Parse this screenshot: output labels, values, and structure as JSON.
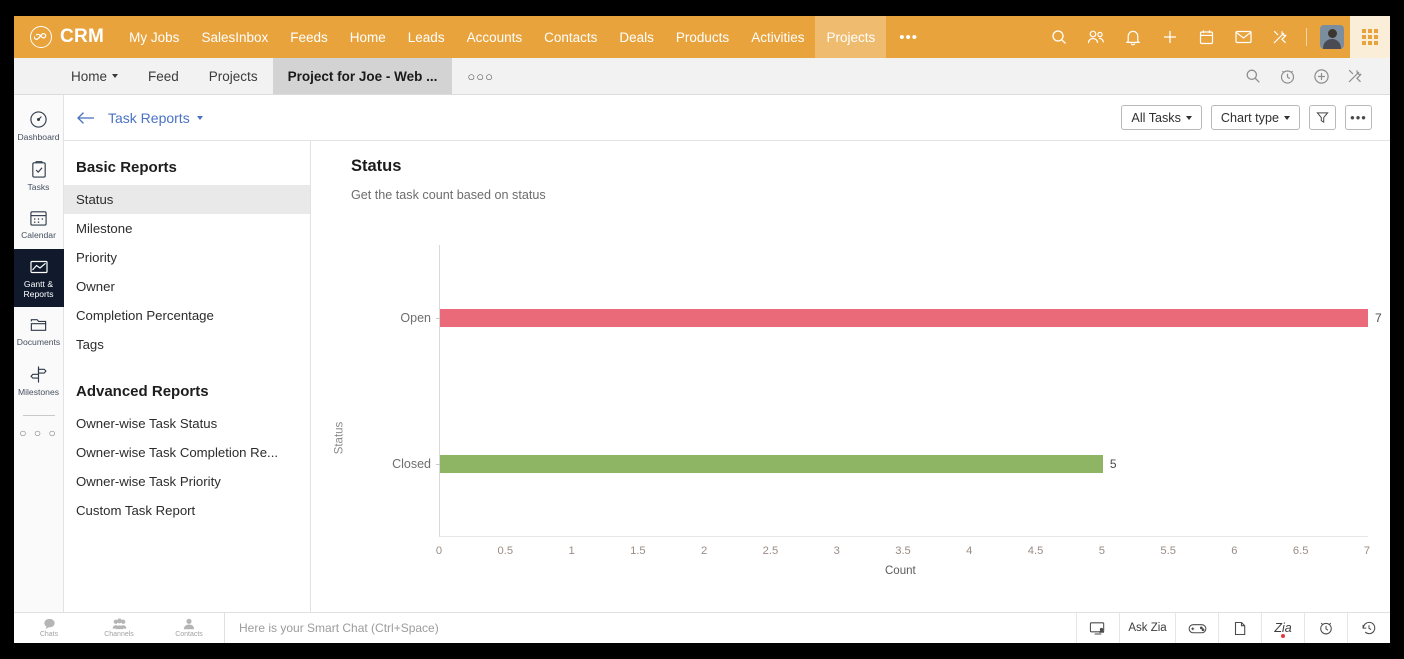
{
  "topbar": {
    "logo_text": "CRM",
    "logo_icon": "zoho-infinity-icon",
    "nav": [
      {
        "label": "My Jobs",
        "active": false
      },
      {
        "label": "SalesInbox",
        "active": false
      },
      {
        "label": "Feeds",
        "active": false
      },
      {
        "label": "Home",
        "active": false
      },
      {
        "label": "Leads",
        "active": false
      },
      {
        "label": "Accounts",
        "active": false
      },
      {
        "label": "Contacts",
        "active": false
      },
      {
        "label": "Deals",
        "active": false
      },
      {
        "label": "Products",
        "active": false
      },
      {
        "label": "Activities",
        "active": false
      },
      {
        "label": "Projects",
        "active": true
      }
    ],
    "more_label": "•••",
    "icons": [
      "search-icon",
      "users-icon",
      "bell-icon",
      "plus-icon",
      "calendar-icon",
      "envelope-icon",
      "tools-icon"
    ],
    "avatar": "user-avatar",
    "apps_grid": "apps-grid-icon",
    "accent_color": "#e8a33d",
    "active_tab_color": "#efbb6e"
  },
  "subbar": {
    "items": [
      {
        "label": "Home",
        "caret": true,
        "active": false
      },
      {
        "label": "Feed",
        "caret": false,
        "active": false
      },
      {
        "label": "Projects",
        "caret": false,
        "active": false
      },
      {
        "label": "Project for Joe - Web ...",
        "caret": false,
        "active": true
      }
    ],
    "more_label": "○○○",
    "icons": [
      "search-icon",
      "timer-icon",
      "plus-circle-icon",
      "tools-icon"
    ]
  },
  "rail": {
    "items": [
      {
        "label": "Dashboard",
        "icon": "gauge-icon",
        "active": false
      },
      {
        "label": "Tasks",
        "icon": "clipboard-check-icon",
        "active": false
      },
      {
        "label": "Calendar",
        "icon": "calendar-icon",
        "active": false
      },
      {
        "label": "Gantt &\nReports",
        "label_line1": "Gantt &",
        "label_line2": "Reports",
        "icon": "chart-area-icon",
        "active": true
      },
      {
        "label": "Documents",
        "icon": "folder-icon",
        "active": false
      },
      {
        "label": "Milestones",
        "icon": "signpost-icon",
        "active": false
      }
    ],
    "more_label": "○ ○ ○",
    "active_bg": "#101a2c"
  },
  "toolbar": {
    "back_icon": "arrow-left-icon",
    "title": "Task Reports",
    "title_caret": true,
    "all_tasks_label": "All Tasks",
    "chart_type_label": "Chart type",
    "filter_icon": "filter-icon",
    "more_label": "•••"
  },
  "reports_panel": {
    "basic_heading": "Basic Reports",
    "basic_items": [
      {
        "label": "Status",
        "active": true
      },
      {
        "label": "Milestone",
        "active": false
      },
      {
        "label": "Priority",
        "active": false
      },
      {
        "label": "Owner",
        "active": false
      },
      {
        "label": "Completion Percentage",
        "active": false
      },
      {
        "label": "Tags",
        "active": false
      }
    ],
    "advanced_heading": "Advanced Reports",
    "advanced_items": [
      {
        "label": "Owner-wise Task Status",
        "active": false
      },
      {
        "label": "Owner-wise Task Completion Re...",
        "active": false
      },
      {
        "label": "Owner-wise Task Priority",
        "active": false
      },
      {
        "label": "Custom Task Report",
        "active": false
      }
    ]
  },
  "main": {
    "title": "Status",
    "subtitle": "Get the task count based on status"
  },
  "chart_data": {
    "type": "bar",
    "orientation": "horizontal",
    "title": "Status",
    "subtitle": "Get the task count based on status",
    "categories": [
      "Open",
      "Closed"
    ],
    "values": [
      7,
      5
    ],
    "colors": [
      "#ea6a79",
      "#8eb563"
    ],
    "data_labels": [
      "7",
      "5"
    ],
    "xlabel": "Count",
    "ylabel": "Status",
    "xlim": [
      0,
      7
    ],
    "xticks": [
      0,
      0.5,
      1,
      1.5,
      2,
      2.5,
      3,
      3.5,
      4,
      4.5,
      5,
      5.5,
      6,
      6.5,
      7
    ],
    "xtick_labels": [
      "0",
      "0.5",
      "1",
      "1.5",
      "2",
      "2.5",
      "3",
      "3.5",
      "4",
      "4.5",
      "5",
      "5.5",
      "6",
      "6.5",
      "7"
    ],
    "grid": false,
    "legend": "none"
  },
  "bottombar": {
    "left_items": [
      {
        "label": "Chats",
        "icon": "chat-bubble-icon"
      },
      {
        "label": "Channels",
        "icon": "channels-icon"
      },
      {
        "label": "Contacts",
        "icon": "contact-person-icon"
      }
    ],
    "chat_placeholder": "Here is your Smart Chat (Ctrl+Space)",
    "right_items": [
      {
        "icon": "screen-share-icon",
        "label": ""
      },
      {
        "icon": "ask-zia-label",
        "label": "Ask Zia"
      },
      {
        "icon": "gamepad-icon",
        "label": ""
      },
      {
        "icon": "note-flag-icon",
        "label": ""
      },
      {
        "icon": "zia-icon",
        "label": "Zia"
      },
      {
        "icon": "alarm-clock-icon",
        "label": ""
      },
      {
        "icon": "history-clock-icon",
        "label": ""
      }
    ]
  }
}
